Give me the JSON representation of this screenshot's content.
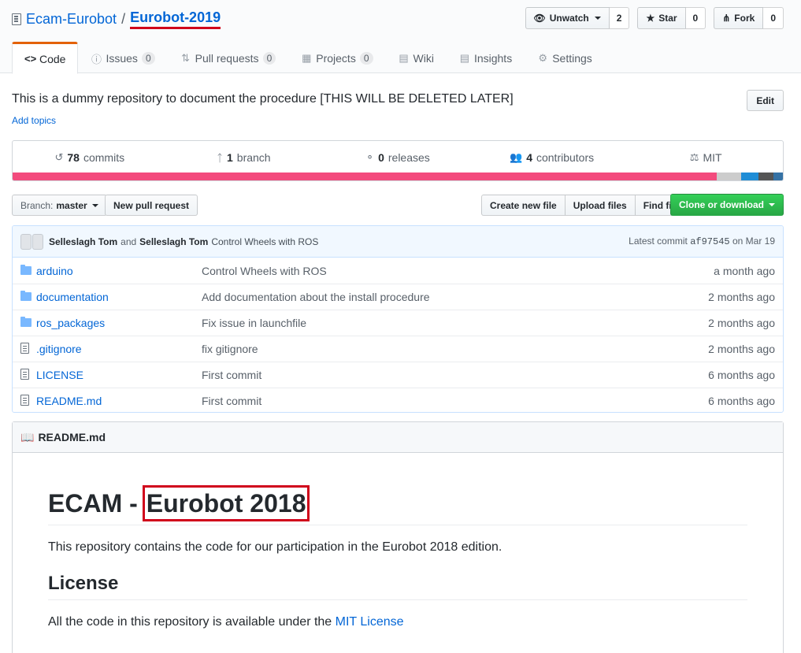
{
  "repo": {
    "owner": "Ecam-Eurobot",
    "separator": "/",
    "name": "Eurobot-2019"
  },
  "actions": {
    "watch_label": "Unwatch",
    "watch_count": "2",
    "star_label": "Star",
    "star_count": "0",
    "fork_label": "Fork",
    "fork_count": "0"
  },
  "tabs": [
    {
      "label": "Code",
      "icon": "<>"
    },
    {
      "label": "Issues",
      "count": "0"
    },
    {
      "label": "Pull requests",
      "count": "0"
    },
    {
      "label": "Projects",
      "count": "0"
    },
    {
      "label": "Wiki"
    },
    {
      "label": "Insights"
    },
    {
      "label": "Settings"
    }
  ],
  "description": "This is a dummy repository to document the procedure [THIS WILL BE DELETED LATER]",
  "add_topics": "Add topics",
  "edit_label": "Edit",
  "summary": {
    "commits_num": "78",
    "commits_label": "commits",
    "branch_num": "1",
    "branch_label": "branch",
    "releases_num": "0",
    "releases_label": "releases",
    "contributors_num": "4",
    "contributors_label": "contributors",
    "license": "MIT"
  },
  "language_bar_colors": [
    "#f34b7d",
    "#cccccc",
    "#1f8dd6",
    "#555555",
    "#3572A5"
  ],
  "branch": {
    "prefix": "Branch:",
    "name": "master"
  },
  "new_pr_label": "New pull request",
  "file_buttons": {
    "create": "Create new file",
    "upload": "Upload files",
    "find": "Find file"
  },
  "clone_label": "Clone or download",
  "commit": {
    "author1": "Selleslagh Tom",
    "and": "and",
    "author2": "Selleslagh Tom",
    "message": "Control Wheels with ROS",
    "latest_label": "Latest commit",
    "sha": "af97545",
    "date": "on Mar 19"
  },
  "files": [
    {
      "name": "arduino",
      "type": "folder",
      "message": "Control Wheels with ROS",
      "age": "a month ago"
    },
    {
      "name": "documentation",
      "type": "folder",
      "message": "Add documentation about the install procedure",
      "age": "2 months ago"
    },
    {
      "name": "ros_packages",
      "type": "folder",
      "message": "Fix issue in launchfile",
      "age": "2 months ago"
    },
    {
      "name": ".gitignore",
      "type": "file",
      "message": "fix gitignore",
      "age": "2 months ago"
    },
    {
      "name": "LICENSE",
      "type": "file",
      "message": "First commit",
      "age": "6 months ago"
    },
    {
      "name": "README.md",
      "type": "file",
      "message": "First commit",
      "age": "6 months ago"
    }
  ],
  "readme": {
    "filename": "README.md",
    "h1_prefix": "ECAM -",
    "h1_highlight": "Eurobot 2018",
    "intro": "This repository contains the code for our participation in the Eurobot 2018 edition.",
    "license_heading": "License",
    "license_text": "All the code in this repository is available under the",
    "license_link": "MIT License"
  }
}
